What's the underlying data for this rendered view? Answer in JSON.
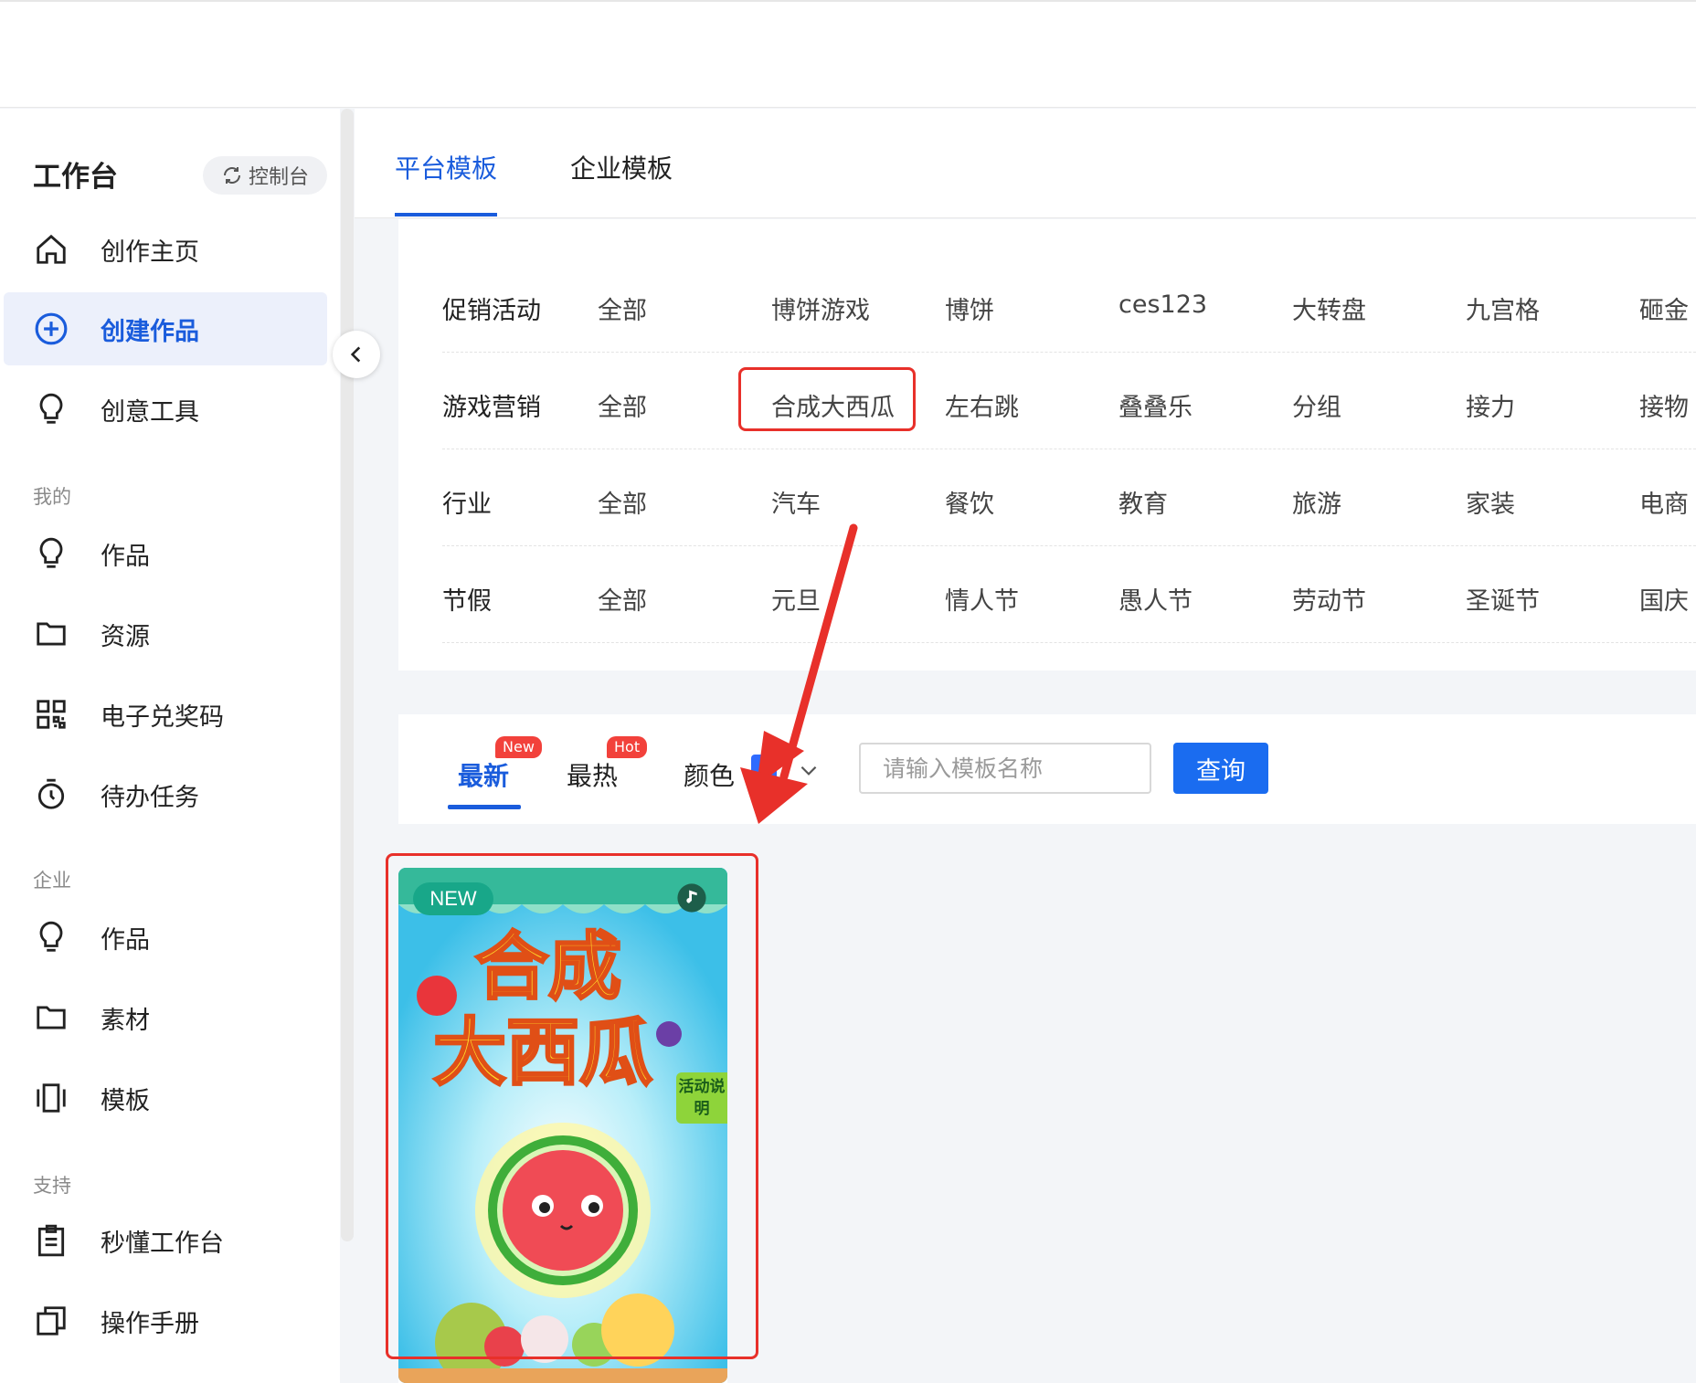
{
  "sidebar": {
    "title": "工作台",
    "console_label": "控制台",
    "items": [
      {
        "label": "创作主页",
        "icon": "home-icon"
      },
      {
        "label": "创建作品",
        "icon": "plus-circle-icon"
      },
      {
        "label": "创意工具",
        "icon": "bulb-icon"
      }
    ],
    "section_mine": "我的",
    "mine_items": [
      {
        "label": "作品",
        "icon": "bulb-icon"
      },
      {
        "label": "资源",
        "icon": "folder-icon"
      },
      {
        "label": "电子兑奖码",
        "icon": "qrcode-icon"
      },
      {
        "label": "待办任务",
        "icon": "stopwatch-icon"
      }
    ],
    "section_enterprise": "企业",
    "enterprise_items": [
      {
        "label": "作品",
        "icon": "bulb-icon"
      },
      {
        "label": "素材",
        "icon": "folder-icon"
      },
      {
        "label": "模板",
        "icon": "template-icon"
      }
    ],
    "section_support": "支持",
    "support_items": [
      {
        "label": "秒懂工作台",
        "icon": "clipboard-icon"
      },
      {
        "label": "操作手册",
        "icon": "copy-icon"
      }
    ]
  },
  "tabs": [
    "平台模板",
    "企业模板"
  ],
  "categories": [
    {
      "label": "促销活动",
      "items": [
        "全部",
        "博饼游戏",
        "博饼",
        "ces123",
        "大转盘",
        "九宫格",
        "砸金"
      ]
    },
    {
      "label": "游戏营销",
      "items": [
        "全部",
        "合成大西瓜",
        "左右跳",
        "叠叠乐",
        "分组",
        "接力",
        "接物"
      ]
    },
    {
      "label": "行业",
      "items": [
        "全部",
        "汽车",
        "餐饮",
        "教育",
        "旅游",
        "家装",
        "电商"
      ]
    },
    {
      "label": "节假",
      "items": [
        "全部",
        "元旦",
        "情人节",
        "愚人节",
        "劳动节",
        "圣诞节",
        "国庆"
      ]
    }
  ],
  "filters": {
    "newest": "最新",
    "newest_badge": "New",
    "hottest": "最热",
    "hottest_badge": "Hot",
    "color_label": "颜色",
    "color_value": "#2f6bff",
    "search_placeholder": "请输入模板名称",
    "query_label": "查询"
  },
  "card": {
    "badge": "NEW",
    "title_line1": "合成",
    "title_line2": "大西瓜",
    "rules_tag": "活动说明"
  },
  "colors": {
    "accent": "#1a5cdc",
    "annotation_red": "#e8302a"
  }
}
